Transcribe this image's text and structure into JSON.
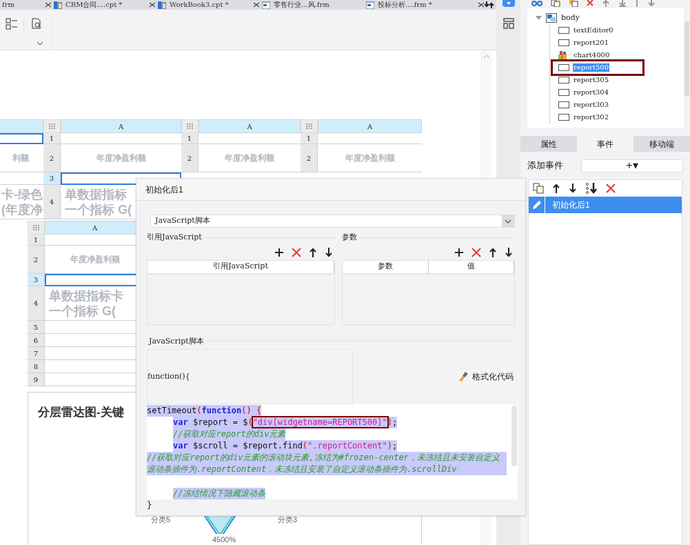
{
  "tabs": [
    {
      "label": "frm",
      "closable": true
    },
    {
      "kind": "cpt",
      "label": "CRM合同....cpt *",
      "closable": true
    },
    {
      "kind": "cpt",
      "label": "WorkBook3.cpt *",
      "closable": true
    },
    {
      "kind": "frm",
      "label": "零售行业...风.frm",
      "closable": false
    },
    {
      "kind": "frm",
      "label": "投标分析....frm *",
      "closable": true
    }
  ],
  "canvas": {
    "widgets": [
      {
        "rows": [
          {
            "selected": true
          },
          {
            "lines": [
              "利额"
            ],
            "selected": false
          },
          {
            "selected": false
          },
          {
            "lines": [
              "卡-绿色",
              "(年度净"
            ],
            "selected": false
          }
        ]
      },
      {
        "column": "A",
        "rows": [
          {
            "number": "1",
            "selected": false
          },
          {
            "number": "2",
            "lines": [
              "年度净盈利额"
            ],
            "selected": false
          },
          {
            "number": "3",
            "selected": true
          },
          {
            "number": "4",
            "lines": [
              "单数据指标",
              "一个指标 G("
            ],
            "selected": false
          }
        ]
      },
      {
        "column": "A",
        "rows": [
          {
            "number": "1",
            "selected": false
          },
          {
            "number": "2",
            "lines": [
              "年度净盈利额"
            ],
            "selected": false
          }
        ]
      },
      {
        "column": "A",
        "rows": [
          {
            "number": "1",
            "selected": false
          },
          {
            "number": "2",
            "lines": [
              "年度净盈利额"
            ],
            "selected": false
          }
        ]
      },
      {
        "column": "A",
        "rows": [
          {
            "number": "1",
            "selected": false
          },
          {
            "number": "2",
            "lines": [
              "年度净盈利额"
            ],
            "selected": false
          },
          {
            "number": "3",
            "selected": true
          },
          {
            "number": "4",
            "lines": [
              "单数据指标卡",
              "一个指标 G("
            ],
            "selected": false
          },
          {
            "number": "5",
            "selected": false
          },
          {
            "number": "6",
            "selected": false
          },
          {
            "number": "7",
            "selected": false
          },
          {
            "number": "8",
            "selected": false
          },
          {
            "number": "9",
            "selected": false
          }
        ]
      }
    ],
    "chart_card": {
      "title": "分层雷达图-关键",
      "labels": [
        "分类5",
        "分类3",
        "4500%"
      ]
    }
  },
  "tree": {
    "root": {
      "label": "body",
      "expanded": true,
      "children": [
        {
          "kind": "report",
          "label": "textEditor0",
          "selected": false,
          "boxed": false
        },
        {
          "kind": "report",
          "label": "report201",
          "selected": false,
          "boxed": false
        },
        {
          "kind": "chart",
          "label": "chart4000",
          "selected": false,
          "boxed": false
        },
        {
          "kind": "report",
          "label": "report500",
          "selected": true,
          "boxed": true
        },
        {
          "kind": "report",
          "label": "report305",
          "selected": false,
          "boxed": false
        },
        {
          "kind": "report",
          "label": "report304",
          "selected": false,
          "boxed": false
        },
        {
          "kind": "report",
          "label": "report303",
          "selected": false,
          "boxed": false
        },
        {
          "kind": "report",
          "label": "report302",
          "selected": false,
          "boxed": false
        }
      ]
    }
  },
  "panel_tabs": [
    {
      "label": "属性",
      "selected": false
    },
    {
      "label": "事件",
      "selected": true
    },
    {
      "label": "移动端",
      "selected": false
    }
  ],
  "add_event": {
    "label": "添加事件",
    "button": "+▾"
  },
  "events": [
    {
      "label": "初始化后1",
      "selected": true
    }
  ],
  "dialog": {
    "title": "初始化后1",
    "type_select": "JavaScript脚本",
    "ref_section": {
      "title": "引用JavaScript",
      "columns": [
        "引用JavaScript"
      ]
    },
    "param_section": {
      "title": "参数",
      "columns": [
        "参数",
        "值"
      ]
    },
    "script_section": {
      "title": "JavaScript脚本",
      "header": "function(){",
      "format_button": "格式化代码",
      "lines": [
        {
          "kind": "code",
          "indent": false,
          "selected": true,
          "parts": [
            {
              "kind": "plain",
              "text": "setTimeout"
            },
            {
              "kind": "paren",
              "text": "("
            },
            {
              "kind": "keyword",
              "text": "function"
            },
            {
              "kind": "paren",
              "text": "() {"
            }
          ]
        },
        {
          "kind": "code",
          "indent": true,
          "selected": true,
          "parts": [
            {
              "kind": "keyword",
              "text": "var"
            },
            {
              "kind": "plain",
              "text": " $report = $"
            },
            {
              "kind": "paren",
              "text": "("
            },
            {
              "kind": "string",
              "text": "\"div[widgetname=REPORT500]\"",
              "boxed": true
            },
            {
              "kind": "paren",
              "text": ")"
            },
            {
              "kind": "plain",
              "text": ";"
            }
          ]
        },
        {
          "kind": "code",
          "indent": true,
          "selected": true,
          "parts": [
            {
              "kind": "comment",
              "text": "//获取对应report的div元素"
            }
          ]
        },
        {
          "kind": "code",
          "indent": true,
          "selected": true,
          "parts": [
            {
              "kind": "keyword",
              "text": "var"
            },
            {
              "kind": "plain",
              "text": " $scroll = $report.find"
            },
            {
              "kind": "paren",
              "text": "("
            },
            {
              "kind": "string",
              "text": "\".reportContent\""
            },
            {
              "kind": "paren",
              "text": ")"
            },
            {
              "kind": "plain",
              "text": ";"
            }
          ]
        },
        {
          "kind": "code",
          "indent": false,
          "selected": true,
          "parts": [
            {
              "kind": "comment",
              "text": "//获取对应report的div元素的滚动块元素,冻结为#frozen-center，未冻结且未安装自定义滚动条插件为.reportContent，未冻结且安装了自定义滚动条插件为.scrollDiv"
            }
          ]
        },
        {
          "kind": "blank"
        },
        {
          "kind": "code",
          "indent": true,
          "selected": true,
          "parts": [
            {
              "kind": "comment",
              "text": "//冻结情况下隐藏滚动条"
            }
          ]
        }
      ],
      "footer": "}"
    }
  }
}
